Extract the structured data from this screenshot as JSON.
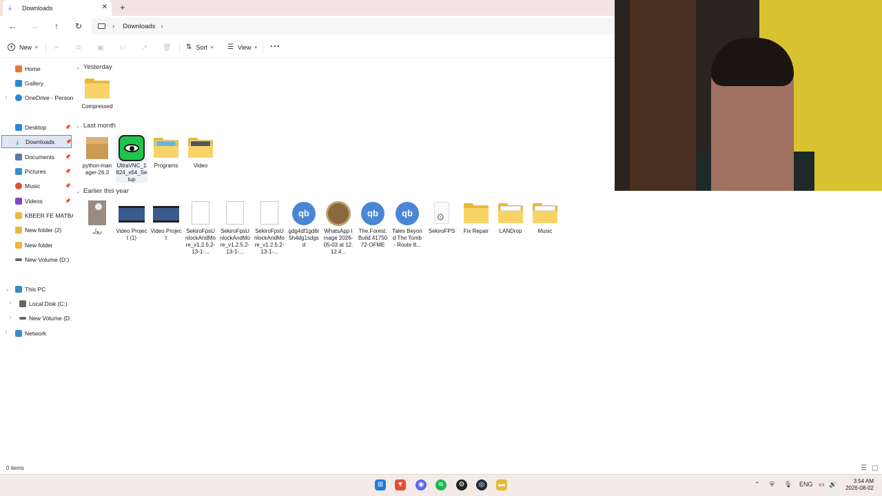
{
  "window": {
    "tab_title": "Downloads",
    "tab_close": "✕",
    "new_tab": "+"
  },
  "address": {
    "back": "←",
    "forward": "→",
    "up": "↑",
    "refresh": "↻",
    "breadcrumb_sep": "›",
    "breadcrumb": "Downloads"
  },
  "toolbar": {
    "new_label": "New",
    "sort_label": "Sort",
    "view_label": "View",
    "more_label": "···"
  },
  "sidebar": {
    "quick": [
      {
        "label": "Home",
        "color": "#e8763a"
      },
      {
        "label": "Gallery",
        "color": "#2f86d8"
      },
      {
        "label": "OneDrive - Personal",
        "color": "#2f86d8"
      }
    ],
    "pinned": [
      {
        "label": "Desktop",
        "color": "#2f86d8"
      },
      {
        "label": "Downloads",
        "color": "#1d9a55"
      },
      {
        "label": "Documents",
        "color": "#5a7aa8"
      },
      {
        "label": "Pictures",
        "color": "#3a8cc8"
      },
      {
        "label": "Music",
        "color": "#e0503c"
      },
      {
        "label": "Videos",
        "color": "#7a4ab8"
      },
      {
        "label": "KBEER FE MATBAKH",
        "color": "#e9b93a"
      },
      {
        "label": "New folder (2)",
        "color": "#e9b93a"
      },
      {
        "label": "New folder",
        "color": "#e9b93a"
      },
      {
        "label": "New Volume (D:)",
        "color": "#666666"
      }
    ],
    "tree": [
      {
        "label": "This PC",
        "color": "#3a8cc8"
      },
      {
        "label": "Local Disk (C:)",
        "color": "#666666"
      },
      {
        "label": "New Volume (D:)",
        "color": "#666666"
      },
      {
        "label": "Network",
        "color": "#3a8cc8"
      }
    ]
  },
  "groups": {
    "yesterday": "Yesterday",
    "last_month": "Last month",
    "earlier": "Earlier this year"
  },
  "files": {
    "yesterday": [
      {
        "name": "Compressed",
        "icon": "folder-icon"
      }
    ],
    "last_month": [
      {
        "name": "python-manager-26.3",
        "icon": "package-icon"
      },
      {
        "name": "UltraVNC_1824_x64_Setup",
        "icon": "ultravnc-icon"
      },
      {
        "name": "Programs",
        "icon": "folder-icon"
      },
      {
        "name": "Video",
        "icon": "folder-icon"
      }
    ],
    "earlier": [
      {
        "name": "رول",
        "icon": "photo-icon"
      },
      {
        "name": "Video Project (1)",
        "icon": "video-icon"
      },
      {
        "name": "Video Project",
        "icon": "video-icon"
      },
      {
        "name": "SekiroFpsUnlockAndMore_v1.2.5.2-13-1-...",
        "icon": "file-icon"
      },
      {
        "name": "SekiroFpsUnlockAndMore_v1.2.5.2-13-1-...",
        "icon": "file-icon"
      },
      {
        "name": "SekiroFpsUnlockAndMore_v1.2.5.2-13-1-...",
        "icon": "file-icon"
      },
      {
        "name": "gdg4df1gd6r5h4dg1sdgsd",
        "icon": "qbittorrent-icon"
      },
      {
        "name": "WhatsApp Image 2026-05-03 at 12.12.4...",
        "icon": "whatsapp-image-icon"
      },
      {
        "name": "The.Forest.Build.4175072-OFME",
        "icon": "qbittorrent-icon"
      },
      {
        "name": "Tales Beyond The Tomb - Route 8...",
        "icon": "qbittorrent-icon"
      },
      {
        "name": "SekiroFPS",
        "icon": "settings-file-icon"
      },
      {
        "name": "Fix Repair",
        "icon": "folder-icon"
      },
      {
        "name": "LANDrop",
        "icon": "folder-icon"
      },
      {
        "name": "Music",
        "icon": "folder-icon"
      }
    ]
  },
  "status": {
    "items": "0 items"
  },
  "taskbar": {
    "lang": "ENG",
    "time": "3:54 AM",
    "date": "2026-08-02"
  }
}
